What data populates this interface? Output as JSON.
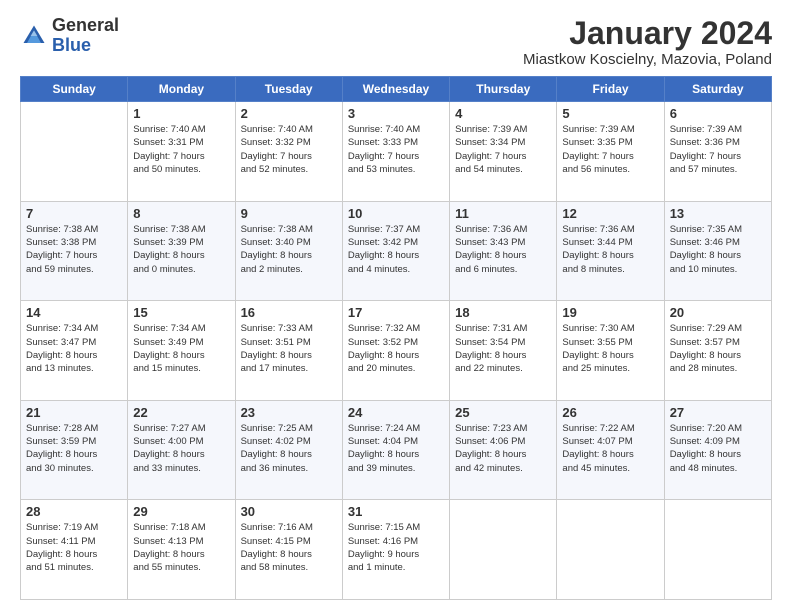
{
  "logo": {
    "general": "General",
    "blue": "Blue"
  },
  "title": "January 2024",
  "subtitle": "Miastkow Koscielny, Mazovia, Poland",
  "days_of_week": [
    "Sunday",
    "Monday",
    "Tuesday",
    "Wednesday",
    "Thursday",
    "Friday",
    "Saturday"
  ],
  "weeks": [
    [
      {
        "day": "",
        "info": ""
      },
      {
        "day": "1",
        "info": "Sunrise: 7:40 AM\nSunset: 3:31 PM\nDaylight: 7 hours\nand 50 minutes."
      },
      {
        "day": "2",
        "info": "Sunrise: 7:40 AM\nSunset: 3:32 PM\nDaylight: 7 hours\nand 52 minutes."
      },
      {
        "day": "3",
        "info": "Sunrise: 7:40 AM\nSunset: 3:33 PM\nDaylight: 7 hours\nand 53 minutes."
      },
      {
        "day": "4",
        "info": "Sunrise: 7:39 AM\nSunset: 3:34 PM\nDaylight: 7 hours\nand 54 minutes."
      },
      {
        "day": "5",
        "info": "Sunrise: 7:39 AM\nSunset: 3:35 PM\nDaylight: 7 hours\nand 56 minutes."
      },
      {
        "day": "6",
        "info": "Sunrise: 7:39 AM\nSunset: 3:36 PM\nDaylight: 7 hours\nand 57 minutes."
      }
    ],
    [
      {
        "day": "7",
        "info": "Sunrise: 7:38 AM\nSunset: 3:38 PM\nDaylight: 7 hours\nand 59 minutes."
      },
      {
        "day": "8",
        "info": "Sunrise: 7:38 AM\nSunset: 3:39 PM\nDaylight: 8 hours\nand 0 minutes."
      },
      {
        "day": "9",
        "info": "Sunrise: 7:38 AM\nSunset: 3:40 PM\nDaylight: 8 hours\nand 2 minutes."
      },
      {
        "day": "10",
        "info": "Sunrise: 7:37 AM\nSunset: 3:42 PM\nDaylight: 8 hours\nand 4 minutes."
      },
      {
        "day": "11",
        "info": "Sunrise: 7:36 AM\nSunset: 3:43 PM\nDaylight: 8 hours\nand 6 minutes."
      },
      {
        "day": "12",
        "info": "Sunrise: 7:36 AM\nSunset: 3:44 PM\nDaylight: 8 hours\nand 8 minutes."
      },
      {
        "day": "13",
        "info": "Sunrise: 7:35 AM\nSunset: 3:46 PM\nDaylight: 8 hours\nand 10 minutes."
      }
    ],
    [
      {
        "day": "14",
        "info": "Sunrise: 7:34 AM\nSunset: 3:47 PM\nDaylight: 8 hours\nand 13 minutes."
      },
      {
        "day": "15",
        "info": "Sunrise: 7:34 AM\nSunset: 3:49 PM\nDaylight: 8 hours\nand 15 minutes."
      },
      {
        "day": "16",
        "info": "Sunrise: 7:33 AM\nSunset: 3:51 PM\nDaylight: 8 hours\nand 17 minutes."
      },
      {
        "day": "17",
        "info": "Sunrise: 7:32 AM\nSunset: 3:52 PM\nDaylight: 8 hours\nand 20 minutes."
      },
      {
        "day": "18",
        "info": "Sunrise: 7:31 AM\nSunset: 3:54 PM\nDaylight: 8 hours\nand 22 minutes."
      },
      {
        "day": "19",
        "info": "Sunrise: 7:30 AM\nSunset: 3:55 PM\nDaylight: 8 hours\nand 25 minutes."
      },
      {
        "day": "20",
        "info": "Sunrise: 7:29 AM\nSunset: 3:57 PM\nDaylight: 8 hours\nand 28 minutes."
      }
    ],
    [
      {
        "day": "21",
        "info": "Sunrise: 7:28 AM\nSunset: 3:59 PM\nDaylight: 8 hours\nand 30 minutes."
      },
      {
        "day": "22",
        "info": "Sunrise: 7:27 AM\nSunset: 4:00 PM\nDaylight: 8 hours\nand 33 minutes."
      },
      {
        "day": "23",
        "info": "Sunrise: 7:25 AM\nSunset: 4:02 PM\nDaylight: 8 hours\nand 36 minutes."
      },
      {
        "day": "24",
        "info": "Sunrise: 7:24 AM\nSunset: 4:04 PM\nDaylight: 8 hours\nand 39 minutes."
      },
      {
        "day": "25",
        "info": "Sunrise: 7:23 AM\nSunset: 4:06 PM\nDaylight: 8 hours\nand 42 minutes."
      },
      {
        "day": "26",
        "info": "Sunrise: 7:22 AM\nSunset: 4:07 PM\nDaylight: 8 hours\nand 45 minutes."
      },
      {
        "day": "27",
        "info": "Sunrise: 7:20 AM\nSunset: 4:09 PM\nDaylight: 8 hours\nand 48 minutes."
      }
    ],
    [
      {
        "day": "28",
        "info": "Sunrise: 7:19 AM\nSunset: 4:11 PM\nDaylight: 8 hours\nand 51 minutes."
      },
      {
        "day": "29",
        "info": "Sunrise: 7:18 AM\nSunset: 4:13 PM\nDaylight: 8 hours\nand 55 minutes."
      },
      {
        "day": "30",
        "info": "Sunrise: 7:16 AM\nSunset: 4:15 PM\nDaylight: 8 hours\nand 58 minutes."
      },
      {
        "day": "31",
        "info": "Sunrise: 7:15 AM\nSunset: 4:16 PM\nDaylight: 9 hours\nand 1 minute."
      },
      {
        "day": "",
        "info": ""
      },
      {
        "day": "",
        "info": ""
      },
      {
        "day": "",
        "info": ""
      }
    ]
  ]
}
